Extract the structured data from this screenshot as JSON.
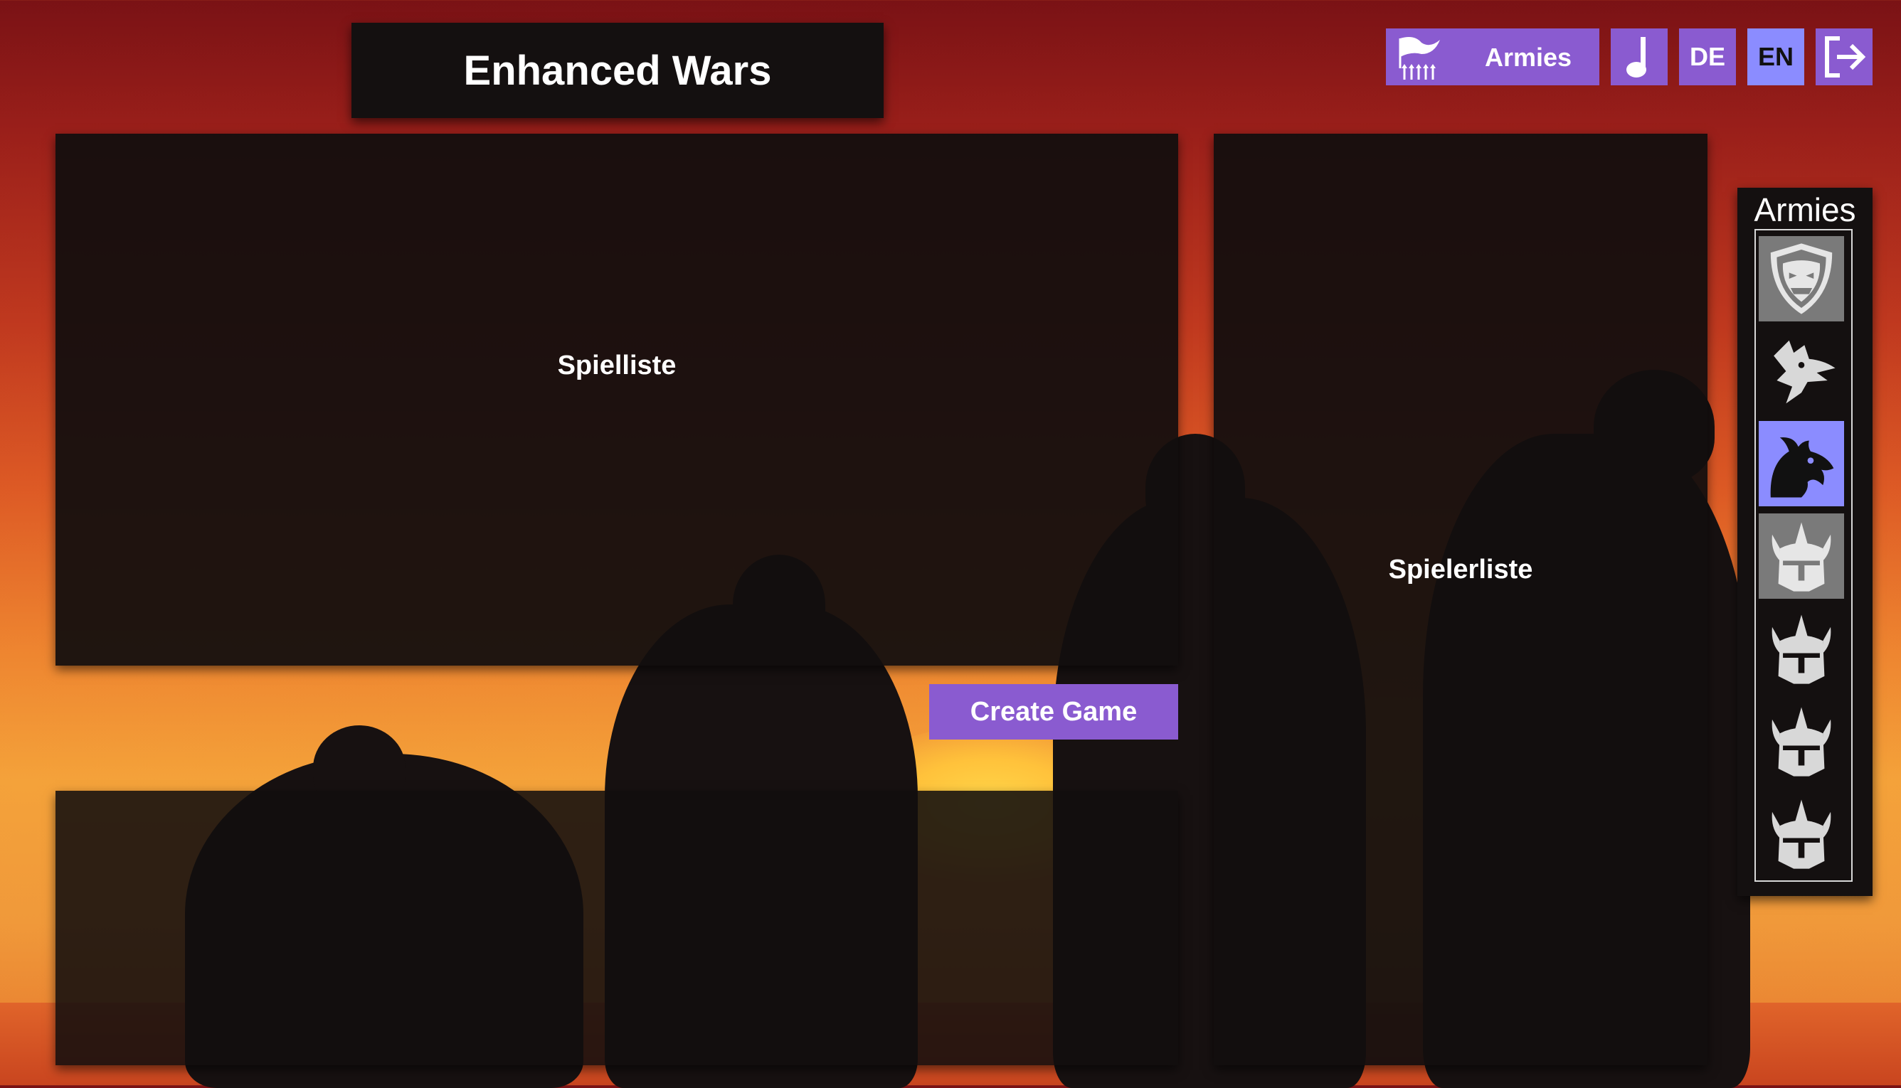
{
  "app": {
    "title": "Enhanced Wars"
  },
  "topbar": {
    "armies_label": "Armies",
    "lang_de": "DE",
    "lang_en": "EN",
    "active_language": "EN"
  },
  "main": {
    "game_list_label": "Spielliste",
    "player_list_label": "Spielerliste",
    "create_game_label": "Create Game"
  },
  "sidebar": {
    "title": "Armies",
    "armies": [
      {
        "icon": "orc-shield-icon",
        "state": "highlighted"
      },
      {
        "icon": "wolf-head-icon",
        "state": "normal"
      },
      {
        "icon": "dragon-head-icon",
        "state": "selected"
      },
      {
        "icon": "spiked-helmet-icon",
        "state": "highlighted"
      },
      {
        "icon": "spiked-helmet-icon",
        "state": "normal"
      },
      {
        "icon": "spiked-helmet-icon",
        "state": "normal"
      },
      {
        "icon": "spiked-helmet-icon",
        "state": "normal"
      }
    ]
  },
  "colors": {
    "accent": "#8a5bd0",
    "selected": "#8b8cff",
    "panel": "#141010"
  }
}
